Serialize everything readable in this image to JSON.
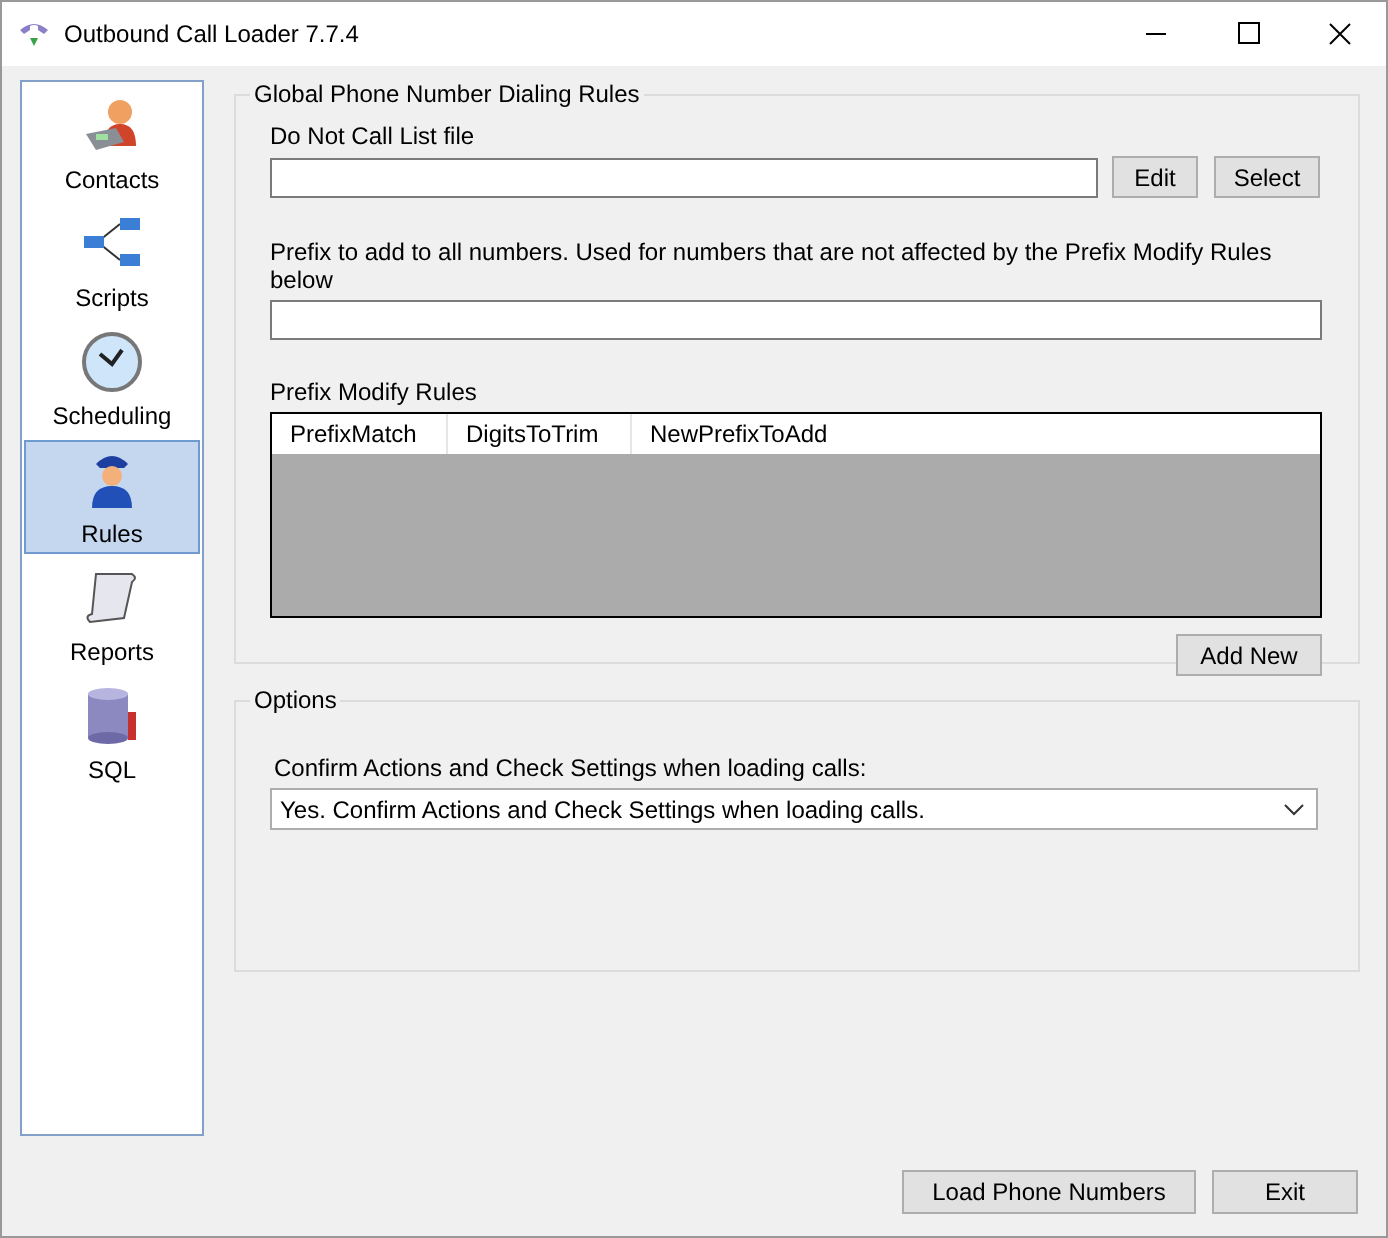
{
  "window": {
    "title": "Outbound Call Loader 7.7.4"
  },
  "sidebar": {
    "items": [
      {
        "label": "Contacts",
        "kind": "contacts",
        "selected": false
      },
      {
        "label": "Scripts",
        "kind": "scripts",
        "selected": false
      },
      {
        "label": "Scheduling",
        "kind": "scheduling",
        "selected": false
      },
      {
        "label": "Rules",
        "kind": "rules",
        "selected": true
      },
      {
        "label": "Reports",
        "kind": "reports",
        "selected": false
      },
      {
        "label": "SQL",
        "kind": "sql",
        "selected": false
      }
    ]
  },
  "dialing_rules": {
    "title": "Global Phone Number Dialing Rules",
    "dnc_label": "Do Not Call List file",
    "dnc_buttons": [
      "Edit",
      "Select"
    ],
    "prefix_label": "Prefix to add to all numbers. Used for numbers that are not affected by the Prefix Modify Rules below",
    "rules_label": "Prefix Modify Rules",
    "rules_table": {
      "columns": [
        "PrefixMatch",
        "DigitsToTrim",
        "NewPrefixToAdd"
      ]
    },
    "add_button": "Add New"
  },
  "options": {
    "title": "Options",
    "confirm_label": "Confirm Actions and Check Settings when loading calls:",
    "confirm_value": "Yes. Confirm Actions and Check Settings when loading calls."
  },
  "buttons": [
    "Load Phone Numbers",
    "Exit"
  ]
}
